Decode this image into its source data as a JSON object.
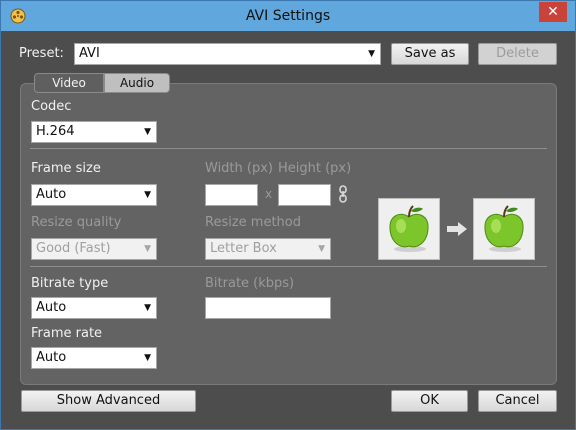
{
  "window": {
    "title": "AVI Settings",
    "close_glyph": "✕"
  },
  "preset": {
    "label": "Preset:",
    "value": "AVI",
    "save_label": "Save as",
    "delete_label": "Delete"
  },
  "tabs": [
    {
      "label": "Video",
      "selected": false
    },
    {
      "label": "Audio",
      "selected": true
    }
  ],
  "codec": {
    "label": "Codec",
    "value": "H.264"
  },
  "frame_size": {
    "label": "Frame size",
    "value": "Auto",
    "width_label": "Width (px)",
    "height_label": "Height (px)",
    "x_sep": "x",
    "width_value": "",
    "height_value": ""
  },
  "resize_quality": {
    "label": "Resize quality",
    "value": "Good (Fast)"
  },
  "resize_method": {
    "label": "Resize method",
    "value": "Letter Box"
  },
  "bitrate_type": {
    "label": "Bitrate type",
    "value": "Auto"
  },
  "bitrate": {
    "label": "Bitrate (kbps)",
    "value": ""
  },
  "frame_rate": {
    "label": "Frame rate",
    "value": "Auto"
  },
  "footer": {
    "advanced_label": "Show Advanced",
    "ok_label": "OK",
    "cancel_label": "Cancel"
  },
  "icons": {
    "app": "film-reel-icon",
    "link": "chain-link-icon",
    "arrow": "arrow-right-icon",
    "preview": "green-apple-icon"
  },
  "colors": {
    "titlebar": "#5fa7dc",
    "close": "#c9433a",
    "body": "#4d4d4d",
    "panel": "#636363",
    "apple": "#7cc52a"
  }
}
